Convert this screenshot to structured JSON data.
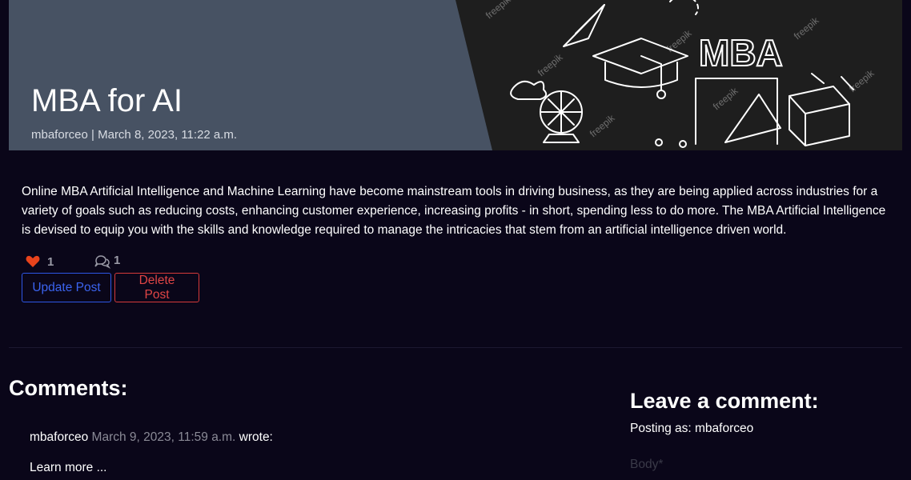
{
  "post": {
    "title": "MBA for AI",
    "meta": "mbaforceo | March 8, 2023, 11:22 a.m.",
    "body": "Online MBA Artificial Intelligence and Machine Learning have become mainstream tools in driving business, as they are being applied across industries for a variety of goals such as reducing costs, enhancing customer experience, increasing profits - in short, spending less to do more. The MBA Artificial Intelligence is devised to equip you with the skills and knowledge required to manage the intricacies that stem from an artificial intelligence driven world.",
    "likes": "1",
    "comments_count": "1"
  },
  "hero_image": {
    "headline": "MBA",
    "watermark": "freepik"
  },
  "actions": {
    "update_label": "Update Post",
    "delete_label": "Delete Post"
  },
  "comments": {
    "heading": "Comments:",
    "items": [
      {
        "author": "mbaforceo",
        "date": "March 9, 2023, 11:59 a.m.",
        "verb": "wrote:",
        "text": "Learn more ..."
      }
    ]
  },
  "comment_form": {
    "heading": "Leave a comment:",
    "posting_as": "Posting as: mbaforceo",
    "body_label": "Body*"
  },
  "icons": {
    "like": "heart-icon",
    "comments": "chat-bubbles-icon"
  },
  "colors": {
    "page_background": "#0a0619",
    "hero_panel": "#475263",
    "chalkboard": "#1e1e1e",
    "like_heart": "#e8431c",
    "update_button": "#3b64f0",
    "delete_button": "#e04545"
  }
}
